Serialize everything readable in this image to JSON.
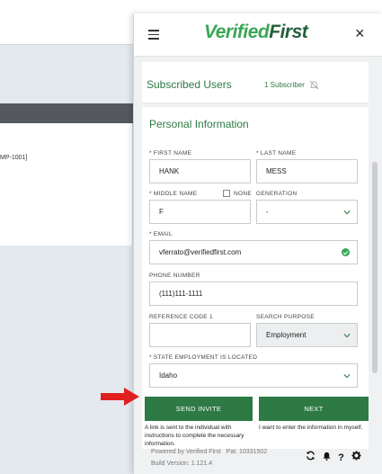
{
  "background": {
    "snippet_text": "MP-1001]"
  },
  "header": {
    "logo_part1": "Verified",
    "logo_part2": "First",
    "menu_icon": "hamburger-icon",
    "close_glyph": "×"
  },
  "subscribed": {
    "title": "Subscribed Users",
    "count": "1 Subscriber",
    "icon": "bell-slash-icon"
  },
  "personal": {
    "title": "Personal Information",
    "first_name": {
      "label": "* FIRST NAME",
      "value": "HANK"
    },
    "last_name": {
      "label": "* LAST NAME",
      "value": "MESS"
    },
    "middle_name": {
      "label": "* MIDDLE NAME",
      "value": "F",
      "none_label": "NONE"
    },
    "generation": {
      "label": "GENERATION",
      "value": "-"
    },
    "email": {
      "label": "* EMAIL",
      "value": "vferrato@verifiedfirst.com"
    },
    "phone": {
      "label": "PHONE NUMBER",
      "value": "(111)111-1111"
    },
    "reference": {
      "label": "REFERENCE CODE 1",
      "value": ""
    },
    "search_purpose": {
      "label": "SEARCH PURPOSE",
      "value": "Employment"
    },
    "state": {
      "label": "* STATE EMPLOYMENT IS LOCATED",
      "value": "Idaho"
    }
  },
  "actions": {
    "send_invite": "SEND INVITE",
    "send_invite_desc": "A link is sent to the individual with instructions to complete the necessary information.",
    "next": "NEXT",
    "next_desc": "I want to enter the information in myself."
  },
  "footer": {
    "powered": "Powered by Verified First",
    "patent": "Pat. 10331502",
    "build": "Build Version: 1.121.4",
    "icons": [
      "refresh-icon",
      "bell-icon",
      "help-icon",
      "gear-icon"
    ]
  },
  "colors": {
    "brand_green": "#2d7a45",
    "light_green": "#3aa655",
    "arrow_red": "#e02020"
  }
}
